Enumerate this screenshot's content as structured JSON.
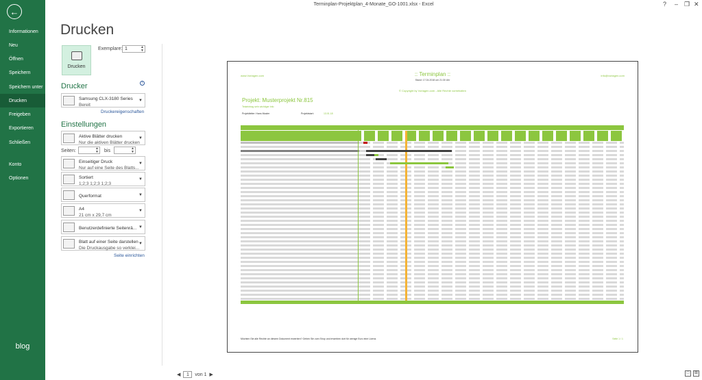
{
  "window": {
    "title": "Terminplan-Projektplan_4-Monate_GO-1001.xlsx - Excel"
  },
  "sidebar": {
    "items": [
      {
        "label": "Informationen"
      },
      {
        "label": "Neu"
      },
      {
        "label": "Öffnen"
      },
      {
        "label": "Speichern"
      },
      {
        "label": "Speichern unter"
      },
      {
        "label": "Drucken"
      },
      {
        "label": "Freigeben"
      },
      {
        "label": "Exportieren"
      },
      {
        "label": "Schließen"
      },
      {
        "label": "Konto"
      },
      {
        "label": "Optionen"
      }
    ],
    "blog": "blog"
  },
  "print": {
    "heading": "Drucken",
    "button_label": "Drucken",
    "copies_label": "Exemplare:",
    "copies_value": "1",
    "printer_heading": "Drucker",
    "printer_name": "Samsung CLX-3180 Series",
    "printer_status": "Bereit",
    "printer_props": "Druckereigenschaften",
    "settings_heading": "Einstellungen",
    "s1_title": "Aktive Blätter drucken",
    "s1_sub": "Nur die aktiven Blätter drucken",
    "pages_label": "Seiten:",
    "pages_to": "bis",
    "s2_title": "Einseitiger Druck",
    "s2_sub": "Nur auf eine Seite des Blatts...",
    "s3_title": "Sortiert",
    "s3_sub": "1;2;3    1;2;3    1;2;3",
    "s4_title": "Querformat",
    "s5_title": "A4",
    "s5_sub": "21 cm x 29,7 cm",
    "s6_title": "Benutzerdefinierte Seitenrä...",
    "s7_title": "Blatt auf einer Seite darstellen",
    "s7_sub": "Die Druckausgabe so verklei...",
    "page_setup": "Seite einrichten"
  },
  "preview": {
    "header_left": "www.Vorlagen.com",
    "title": ":: Terminplan ::",
    "stand": "Stand: 17.04.2018 um 21:30 Uhr",
    "header_right": "info@vorlagen.com",
    "copyright": "© Copyright by Vorlagen.com - Alle Rechte vorbehalten",
    "project": "Projekt: Musterprojekt Nr.815",
    "subtitle": "Testeintrag sehr wichtiger Info",
    "leader_label": "Projektleiter: Hans Muster",
    "start_label": "Projektstart:",
    "start_value": "13.01.18",
    "footer_note": "Möchten Sie alle Rechte an diesem Dokument erwerben? Gehen Sie zum Shop und erwerben dort für wenige Euro eine Lizenz.",
    "page_label": "Seite 1 / 1"
  },
  "pager": {
    "current": "1",
    "of": "von 1"
  },
  "colors": {
    "accent": "#217346",
    "gantt_green": "#8cc63f",
    "today": "#f5b335",
    "delay": "#c00000"
  }
}
